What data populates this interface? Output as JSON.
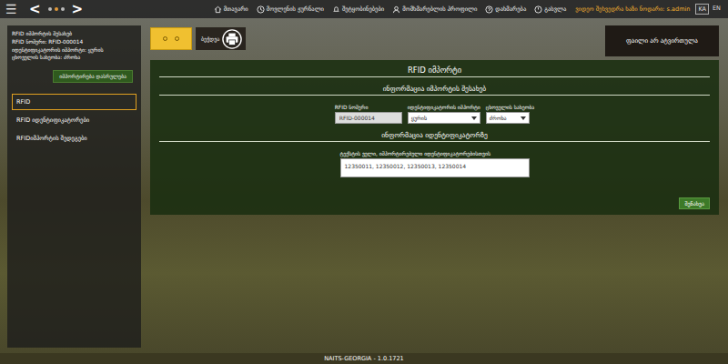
{
  "topbar": {
    "menu_icon": "☰",
    "back": "<",
    "forward": ">",
    "nav": [
      {
        "label": "მთავარი"
      },
      {
        "label": "მოვლენის ჟურნალი"
      },
      {
        "label": "შეტყობინებები"
      },
      {
        "label": "მომხმარებლის პროფილი"
      },
      {
        "label": "დახმარება"
      },
      {
        "label": "გასვლა"
      }
    ],
    "user": "ვიდეო შეხვედრა ხაზი ნოდარი: s.admin",
    "languages": [
      {
        "label": "KA",
        "selected": true
      },
      {
        "label": "EN",
        "selected": false
      }
    ]
  },
  "sidebar": {
    "info": [
      "RFID იმპორტის შესახებ",
      "RFID ნომერი: RFID-000014",
      "იდენტიფიკატორის იმპორტი: ყურის",
      "ცხოველის სახეობა: ძროხა"
    ],
    "finish_button": "იმპორტირება დასრულება",
    "items": [
      {
        "label": "RFID",
        "selected": true
      },
      {
        "label": "RFID იდენტიფიკატორები",
        "selected": false
      },
      {
        "label": "RFIDიმპორტის შედეგები",
        "selected": false
      }
    ]
  },
  "toolbar": {
    "print_label": "ბეჭდვა"
  },
  "file_status": "ფაილი არ ატვირთულა",
  "form": {
    "title": "RFID იმპორტი",
    "section1": "ინფორმაცია იმპორტის შესახებ",
    "fields": [
      {
        "label": "RFID ნომერი",
        "value": "RFID-000014",
        "kind": "input"
      },
      {
        "label": "იდენტიფიკატორის იმპორტი",
        "value": "ყურის",
        "kind": "select"
      },
      {
        "label": "ცხოველის სახეობა",
        "value": "ძროხა",
        "kind": "select"
      }
    ],
    "section2": "ინფორმაცია იდენტიფიკატორზე",
    "text_label": "ტექსტის ველი, იმპორტირებული იდენტიფიკატორებისთვის",
    "text_value": "12350011, 12350012, 12350013, 12350014",
    "save": "შენახვა"
  },
  "footer": "NAITS-GEORGIA - 1.0.1721"
}
